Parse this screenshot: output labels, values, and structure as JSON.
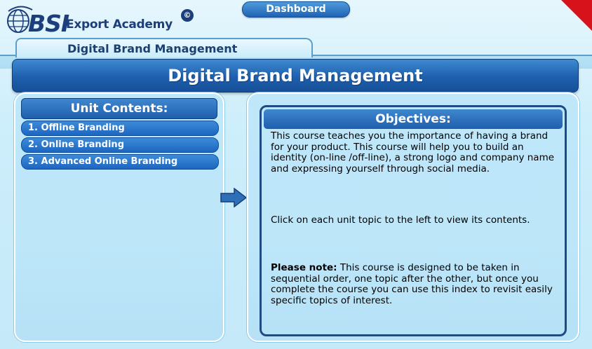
{
  "logo": {
    "bsi_text": "BSI",
    "academy_text": "Export Academy",
    "copyright_symbol": "©"
  },
  "dashboard_label": "Dashboard",
  "breadcrumb": "Digital Brand Management",
  "page_title": "Digital Brand Management",
  "units": {
    "header": "Unit Contents:",
    "items": [
      {
        "label": "1. Offline Branding"
      },
      {
        "label": "2. Online Branding"
      },
      {
        "label": "3. Advanced Online Branding"
      }
    ]
  },
  "objectives": {
    "header": "Objectives:",
    "paragraph1": "This course teaches you the importance of having a brand for your product. This course will help you to build an identity (on-line /off-line), a strong logo and company name and expressing yourself through social media.",
    "paragraph2": "Click on each unit topic to the left to view its contents.",
    "note_lead": "Please note:",
    "note_text": " This course is designed to be taken in sequential order, one topic after the other, but once you complete the course you can use this index to revisit easily specific topics of interest."
  },
  "colors": {
    "accent_blue": "#1f5fad",
    "corner_red": "#d8121b",
    "background": "#c5e9f9"
  },
  "icons": {
    "logo_globe": "globe-icon",
    "arrow": "arrow-right-icon"
  }
}
